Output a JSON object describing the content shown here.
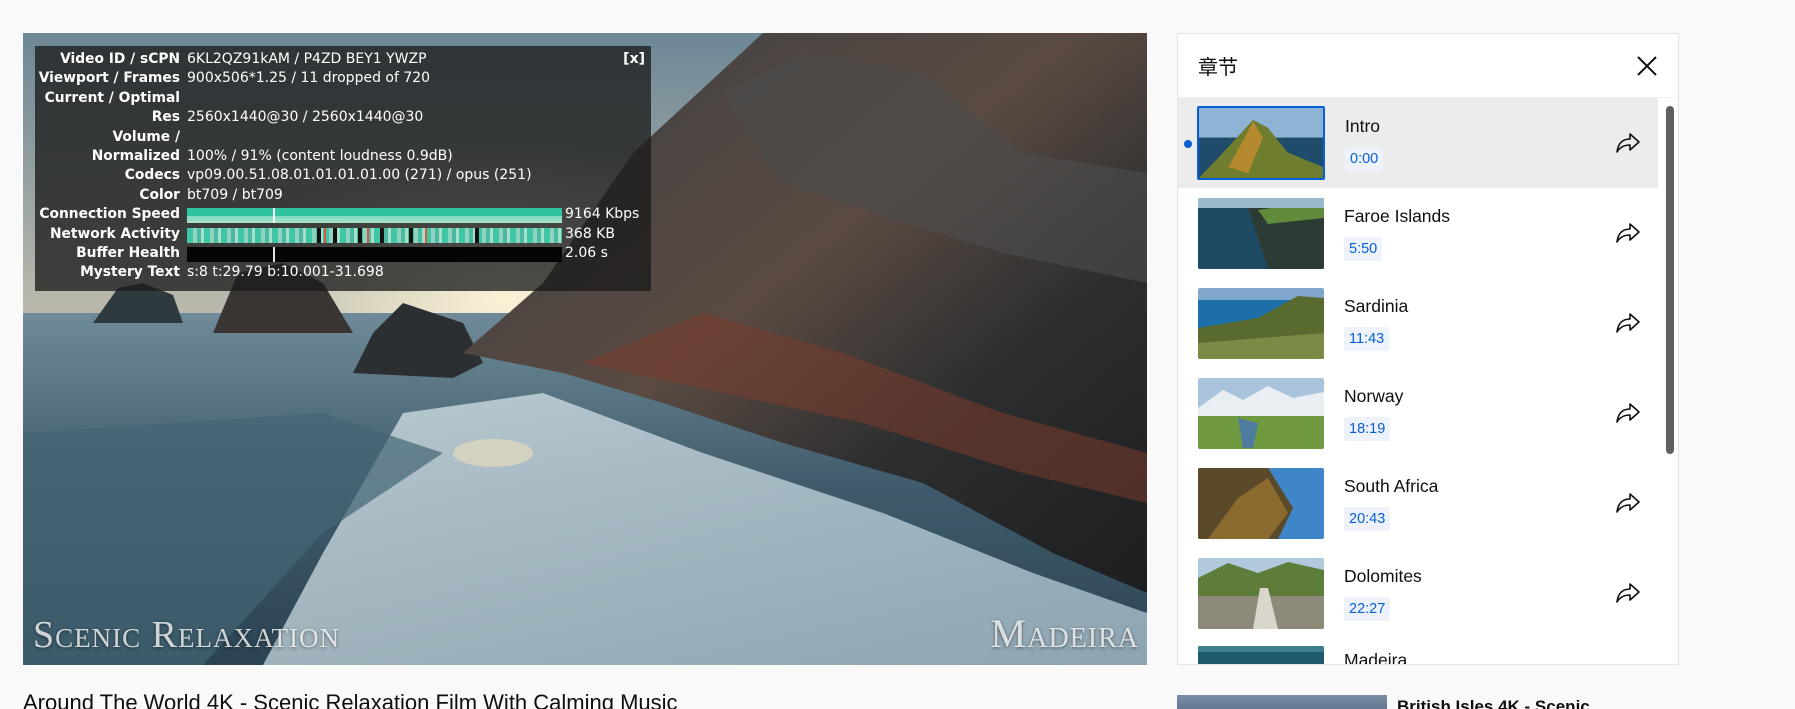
{
  "player": {
    "watermark_left": "Scenic Relaxation",
    "watermark_right": "Madeira"
  },
  "stats": {
    "close_label": "[x]",
    "rows": [
      {
        "key": "Video ID / sCPN",
        "value": "6KL2QZ91kAM / P4ZD BEY1 YWZP"
      },
      {
        "key": "Viewport / Frames",
        "value": "900x506*1.25 / 11 dropped of 720"
      },
      {
        "key": "Current / Optimal",
        "value": ""
      },
      {
        "key": "Res",
        "value": "2560x1440@30 / 2560x1440@30"
      },
      {
        "key": "Volume /",
        "value": ""
      },
      {
        "key": "Normalized",
        "value": "100% / 91% (content loudness 0.9dB)"
      },
      {
        "key": "Codecs",
        "value": "vp09.00.51.08.01.01.01.01.00 (271) / opus (251)"
      },
      {
        "key": "Color",
        "value": "bt709 / bt709"
      },
      {
        "key": "Connection Speed",
        "value": "9164 Kbps"
      },
      {
        "key": "Network Activity",
        "value": "368 KB"
      },
      {
        "key": "Buffer Health",
        "value": "2.06 s"
      },
      {
        "key": "Mystery Text",
        "value": "s:8 t:29.79 b:10.001-31.698"
      }
    ]
  },
  "video_title": "Around The World 4K - Scenic Relaxation Film With Calming Music",
  "chapters": {
    "title": "章节",
    "items": [
      {
        "name": "Intro",
        "time": "0:00"
      },
      {
        "name": "Faroe Islands",
        "time": "5:50"
      },
      {
        "name": "Sardinia",
        "time": "11:43"
      },
      {
        "name": "Norway",
        "time": "18:19"
      },
      {
        "name": "South Africa",
        "time": "20:43"
      },
      {
        "name": "Dolomites",
        "time": "22:27"
      },
      {
        "name": "Madeira",
        "time": ""
      }
    ]
  },
  "next_up": {
    "title": "British Isles 4K - Scenic"
  },
  "colors": {
    "accent": "#065fd4",
    "panel_bg": "#ffffff",
    "page_bg": "#f9f9f9"
  }
}
